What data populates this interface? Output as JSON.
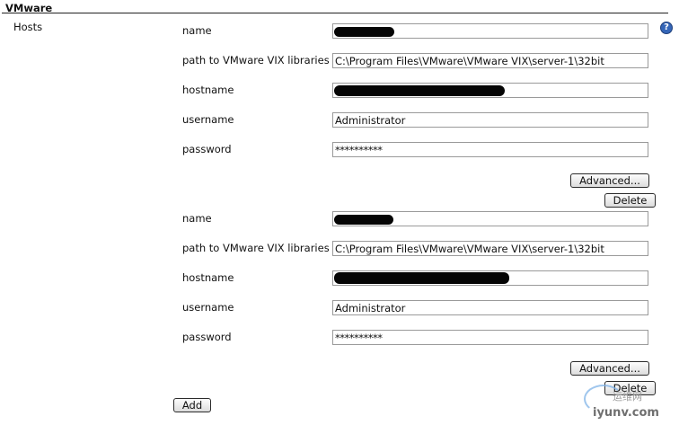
{
  "section": {
    "title": "VMware",
    "hosts_label": "Hosts"
  },
  "help_icon": {
    "glyph": "?",
    "name": "help-icon"
  },
  "labels": {
    "name": "name",
    "path": "path to VMware VIX libraries",
    "hostname": "hostname",
    "username": "username",
    "password": "password"
  },
  "hosts": [
    {
      "name": "",
      "path": "C:\\Program Files\\VMware\\VMware VIX\\server-1\\32bit",
      "hostname": "",
      "username": "Administrator",
      "password": "**********",
      "advanced_label": "Advanced...",
      "delete_label": "Delete"
    },
    {
      "name": "",
      "path": "C:\\Program Files\\VMware\\VMware VIX\\server-1\\32bit",
      "hostname": "",
      "username": "Administrator",
      "password": "**********",
      "advanced_label": "Advanced...",
      "delete_label": "Delete"
    }
  ],
  "add_label": "Add",
  "watermark": {
    "cn": "运维网",
    "url": "iyunv.com"
  },
  "colors": {
    "help_icon": "#3566b8",
    "field_border": "#9a9a9a",
    "redaction": "#050505"
  }
}
